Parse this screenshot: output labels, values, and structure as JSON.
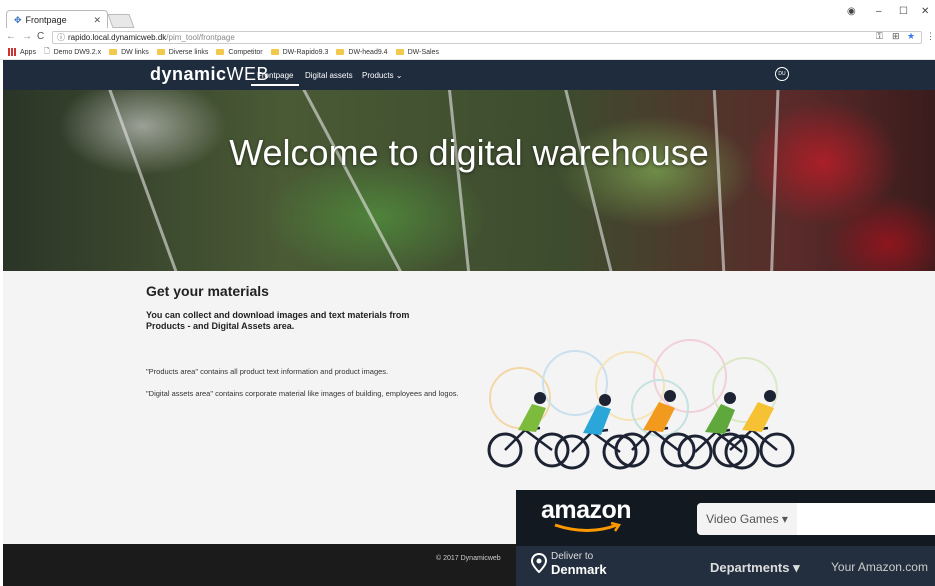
{
  "browser": {
    "tab_title": "Frontpage",
    "url_host": "rapido.local.dynamicweb.dk",
    "url_path": "/pim_tool/frontpage",
    "bookmarks": [
      "Apps",
      "Demo DW9.2.x",
      "DW links",
      "Diverse links",
      "Competitor",
      "DW-Rapido9.3",
      "DW-head9.4",
      "DW-Sales"
    ]
  },
  "site": {
    "logo_bold": "dynamic",
    "logo_light": "WEB",
    "nav": [
      "Frontpage",
      "Digital assets",
      "Products ⌄"
    ],
    "user_initials": "DU"
  },
  "hero": {
    "title": "Welcome to digital warehouse"
  },
  "main": {
    "heading": "Get your materials",
    "lead": "You can collect and download images and text materials from Products - and Digital Assets area.",
    "p1": "\"Products area\" contains all product text information and product images.",
    "p2": "\"Digital assets area\" contains corporate material like images of building, employees and logos."
  },
  "footer": {
    "copyright": "© 2017 Dynamicweb"
  },
  "amazon": {
    "logo": "amazon",
    "search_category": "Video Games ▾",
    "deliver_label": "Deliver to",
    "deliver_country": "Denmark",
    "departments": "Departments ▾",
    "your_amazon": "Your Amazon.com"
  },
  "colors": {
    "nav_bg": "#1e2c3d",
    "footer_bg": "#1b1b1b",
    "amazon_bg": "#131921",
    "amazon_accent": "#ff9900"
  }
}
